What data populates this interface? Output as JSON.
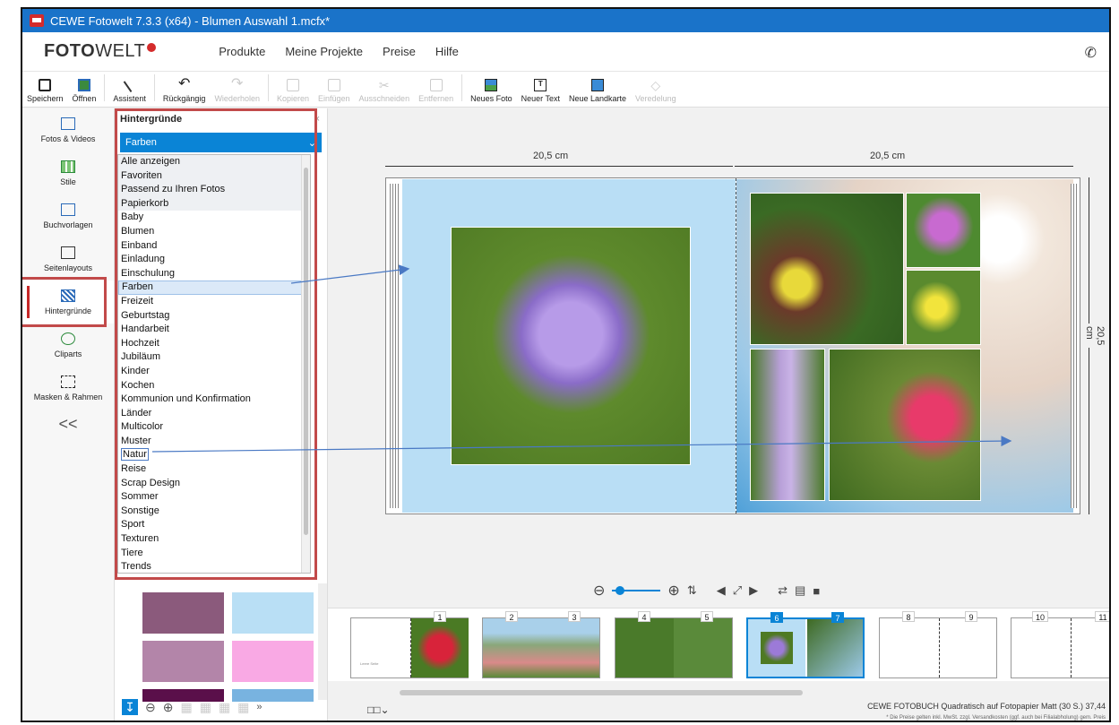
{
  "window": {
    "title": "CEWE Fotowelt 7.3.3 (x64) - Blumen Auswahl 1.mcfx*"
  },
  "brand": {
    "bold": "FOTO",
    "thin": "WELT"
  },
  "menu": [
    "Produkte",
    "Meine Projekte",
    "Preise",
    "Hilfe"
  ],
  "icons": {
    "phone": "phone-icon"
  },
  "toolbar": {
    "save": "Speichern",
    "open": "Öffnen",
    "assistant": "Assistent",
    "undo": "Rückgängig",
    "redo": "Wiederholen",
    "copy": "Kopieren",
    "paste": "Einfügen",
    "cut": "Ausschneiden",
    "delete": "Entfernen",
    "new_photo": "Neues Foto",
    "new_text": "Neuer Text",
    "new_map": "Neue Landkarte",
    "refine": "Veredelung"
  },
  "leftnav": {
    "photos": "Fotos & Videos",
    "styles": "Stile",
    "templates": "Buchvorlagen",
    "layouts": "Seitenlayouts",
    "backgrounds": "Hintergründe",
    "cliparts": "Cliparts",
    "masks": "Masken & Rahmen",
    "collapse": "<<"
  },
  "panel": {
    "title": "Hintergründe",
    "close": "×",
    "selected_category": "Farben",
    "categories": [
      "Alle anzeigen",
      "Favoriten",
      "Passend zu Ihren Fotos",
      "Papierkorb",
      "Baby",
      "Blumen",
      "Einband",
      "Einladung",
      "Einschulung",
      "Farben",
      "Freizeit",
      "Geburtstag",
      "Handarbeit",
      "Hochzeit",
      "Jubiläum",
      "Kinder",
      "Kochen",
      "Kommunion und Konfirmation",
      "Länder",
      "Multicolor",
      "Muster",
      "Natur",
      "Reise",
      "Scrap Design",
      "Sommer",
      "Sonstige",
      "Sport",
      "Texturen",
      "Tiere",
      "Trends"
    ],
    "swatch_colors": [
      "#8b5a7c",
      "#b9dff5",
      "#b385a9",
      "#f9a9e4",
      "#5a0f4a",
      "#78b3e0"
    ]
  },
  "spread": {
    "left_width": "20,5 cm",
    "right_width": "20,5 cm",
    "height": "20,5 cm"
  },
  "filmstrip": {
    "pages": [
      "1",
      "2",
      "3",
      "4",
      "5",
      "6",
      "7",
      "8",
      "9",
      "10",
      "11"
    ],
    "cover_text": "Leere Seite"
  },
  "status": {
    "product": "CEWE FOTOBUCH Quadratisch auf Fotopapier Matt (30 S.) 37,44",
    "note": "* Die Preise gelten inkl. MwSt. zzgl. Versandkosten (ggf. auch bei Filialabholung) gem. Preis"
  }
}
